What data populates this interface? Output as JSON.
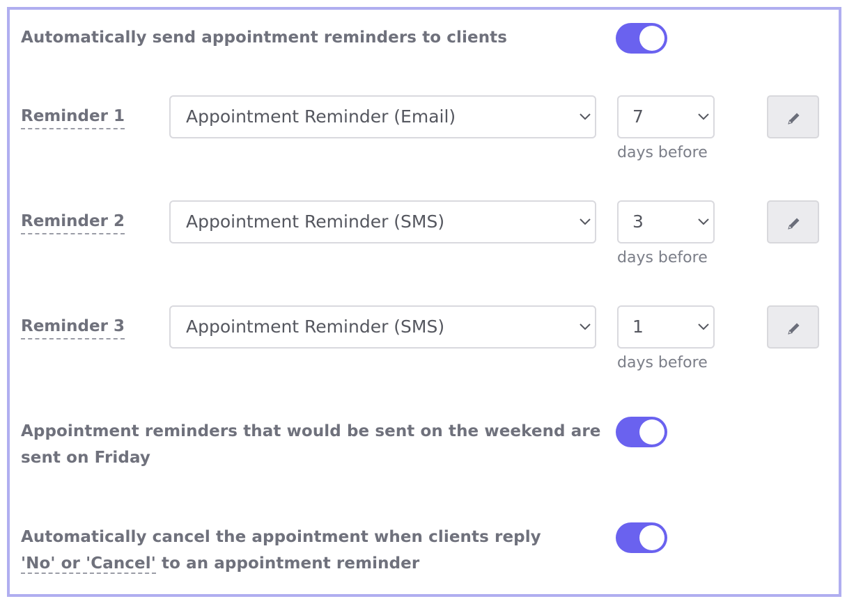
{
  "colors": {
    "accent": "#6a62ef",
    "frame_border": "#b0aef0"
  },
  "settings": {
    "auto_send": {
      "label": "Automatically send appointment reminders to clients",
      "enabled": true
    },
    "weekend": {
      "line1": "Appointment reminders that would be sent on the weekend are",
      "line2": "sent on Friday",
      "enabled": true
    },
    "auto_cancel": {
      "line1": "Automatically cancel the appointment when clients reply",
      "link": "'No' or 'Cancel'",
      "line2_rest": " to an appointment reminder",
      "enabled": true
    }
  },
  "reminders": [
    {
      "label": "Reminder 1",
      "template": "Appointment Reminder (Email)",
      "days": "7",
      "days_suffix": "days before",
      "edit_icon": "pencil-icon"
    },
    {
      "label": "Reminder 2",
      "template": "Appointment Reminder (SMS)",
      "days": "3",
      "days_suffix": "days before",
      "edit_icon": "pencil-icon"
    },
    {
      "label": "Reminder 3",
      "template": "Appointment Reminder (SMS)",
      "days": "1",
      "days_suffix": "days before",
      "edit_icon": "pencil-icon"
    }
  ]
}
